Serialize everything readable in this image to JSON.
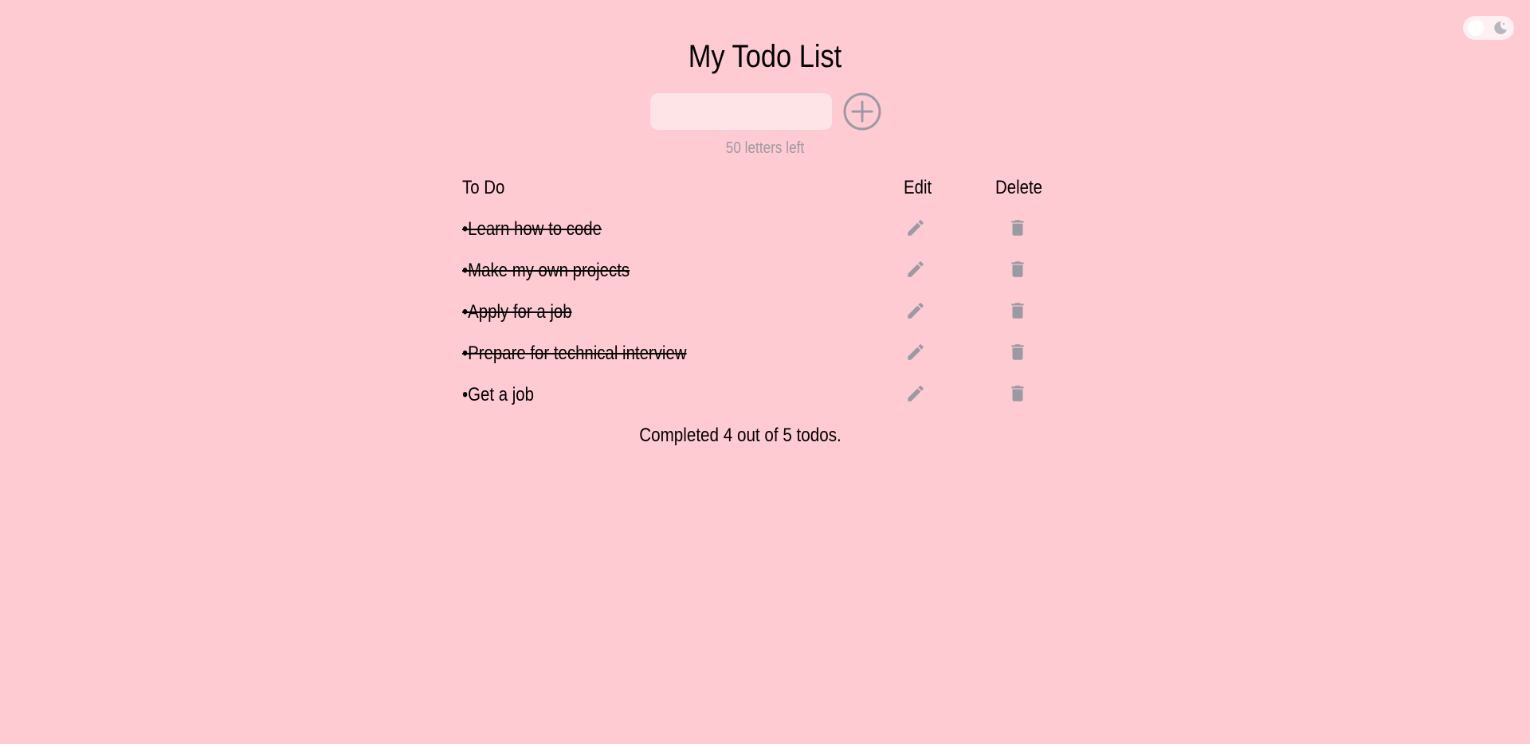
{
  "app": {
    "title": "My Todo List"
  },
  "theme_toggle": {
    "knob_icon": "sun-knob",
    "moon_icon": "moon-icon"
  },
  "new_todo": {
    "value": "",
    "placeholder": "",
    "letters_left": "50 letters left",
    "add_icon": "plus-circle-icon"
  },
  "columns": {
    "todo": "To Do",
    "edit": "Edit",
    "delete": "Delete"
  },
  "todos": [
    {
      "text": "•Learn how to code",
      "completed": true
    },
    {
      "text": "•Make my own projects",
      "completed": true
    },
    {
      "text": "•Apply for a job",
      "completed": true
    },
    {
      "text": "•Prepare for technical interview",
      "completed": true
    },
    {
      "text": "•Get a job",
      "completed": false
    }
  ],
  "summary": "Completed 4 out of 5 todos.",
  "colors": {
    "background": "#ffcbd3",
    "input_background": "#ffe4e7",
    "icon_gray": "#9a9aa3",
    "text": "#000000"
  }
}
